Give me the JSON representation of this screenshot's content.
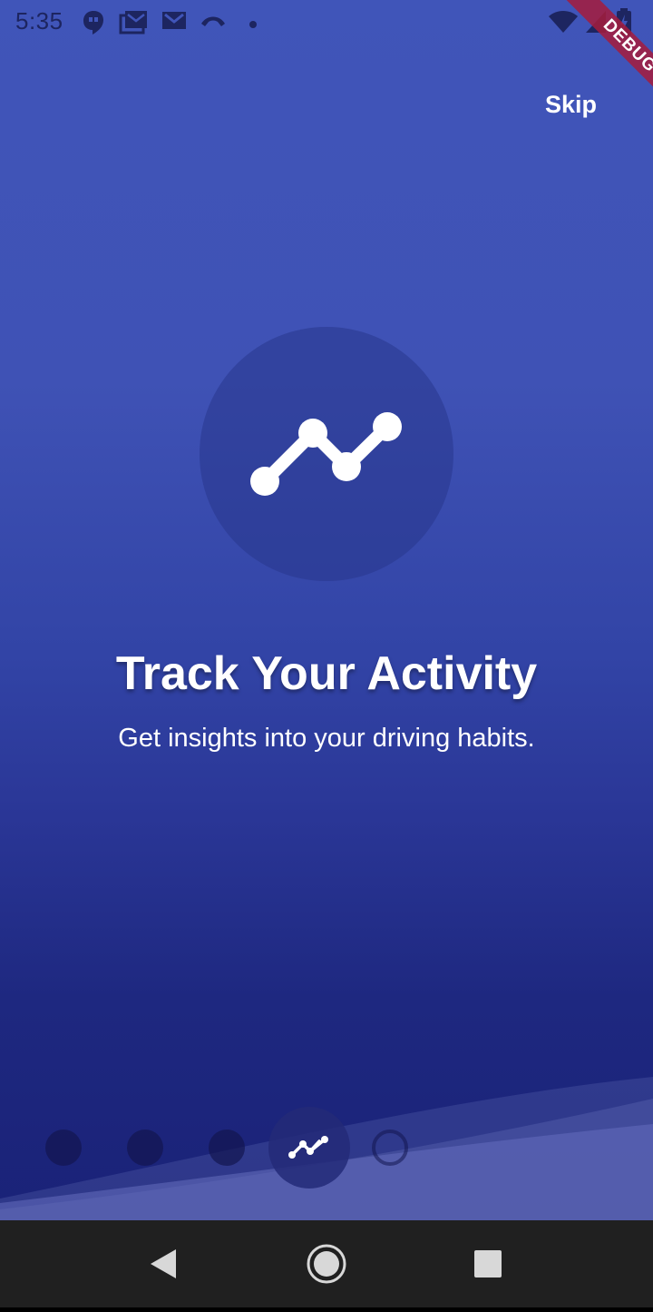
{
  "status_bar": {
    "time": "5:35",
    "left_icons": [
      "hangouts-icon",
      "gmail-stack-icon",
      "gmail-icon",
      "missed-call-icon",
      "notification-dot-icon"
    ],
    "right_icons": [
      "wifi-icon",
      "signal-icon",
      "battery-charging-icon"
    ]
  },
  "debug_banner": {
    "label": "DEBUG"
  },
  "header": {
    "skip_label": "Skip"
  },
  "onboarding": {
    "hero_icon": "trending-line-icon",
    "title": "Track Your Activity",
    "subtitle": "Get insights into your driving habits."
  },
  "page_indicator": {
    "total_pages": 5,
    "current_page": 4
  },
  "nav_bar": {
    "buttons": [
      "back-icon",
      "home-icon",
      "recents-icon"
    ]
  },
  "colors": {
    "background_top": "#4055b9",
    "background_bottom": "#1a2278",
    "debug_ribbon": "#a61c3c",
    "text": "#ffffff",
    "nav_bar": "#202020"
  }
}
